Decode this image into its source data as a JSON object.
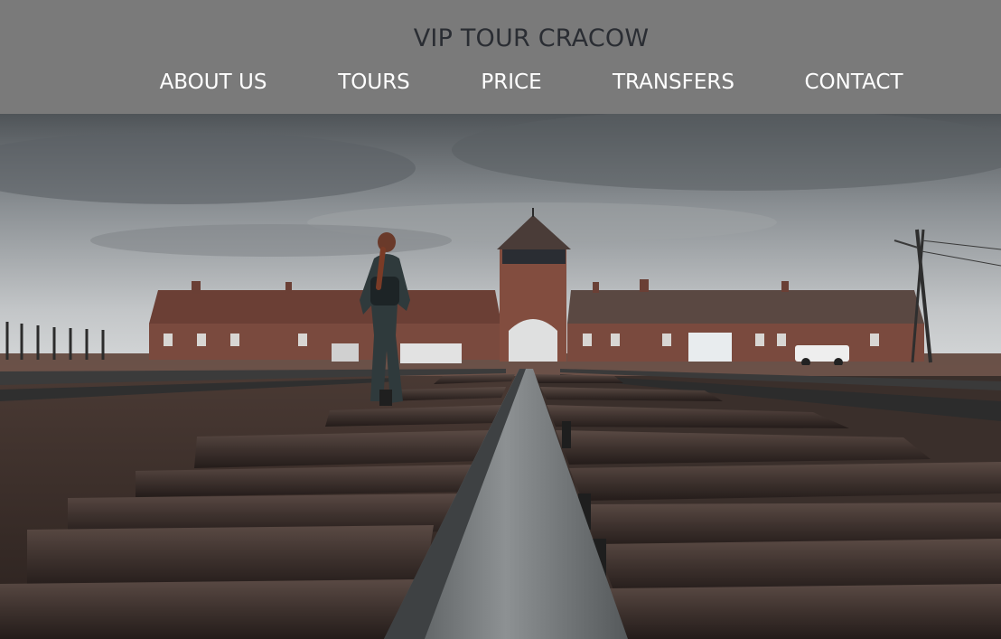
{
  "header": {
    "title": "VIP TOUR CRACOW",
    "nav": [
      "ABOUT US",
      "TOURS",
      "PRICE",
      "TRANSFERS",
      "CONTACT"
    ]
  },
  "hero": {
    "image": "railway tracks leading to a brick gatehouse under an overcast sky, a woman with a backpack walking along the tracks"
  },
  "colors": {
    "header_bg": "#7a7a7a",
    "title": "#2a2d33",
    "nav_text": "#ffffff"
  }
}
